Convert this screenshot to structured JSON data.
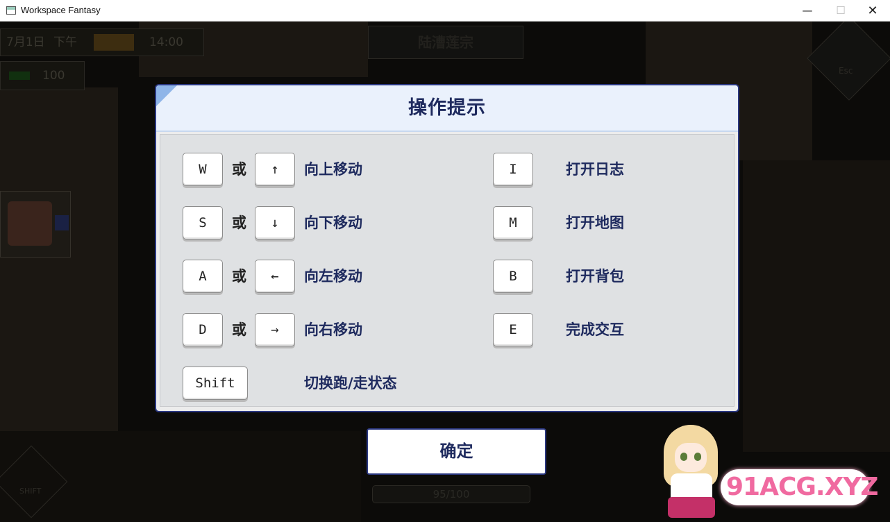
{
  "window": {
    "title": "Workspace Fantasy",
    "min": "—",
    "max": "☐",
    "close": "✕"
  },
  "hud": {
    "date": "7月1日",
    "period": "下午",
    "time": "14:00",
    "energy": "100",
    "location": "陆漕莲宗",
    "settings_label": "Esc",
    "shift_label": "SHIFT",
    "progress": "95/100"
  },
  "dialog": {
    "title": "操作提示",
    "or_label": "或",
    "left_controls": [
      {
        "key": "W",
        "alt_key": "↑",
        "action": "向上移动"
      },
      {
        "key": "S",
        "alt_key": "↓",
        "action": "向下移动"
      },
      {
        "key": "A",
        "alt_key": "←",
        "action": "向左移动"
      },
      {
        "key": "D",
        "alt_key": "→",
        "action": "向右移动"
      }
    ],
    "shift": {
      "key": "Shift",
      "action": "切换跑/走状态"
    },
    "right_controls": [
      {
        "key": "I",
        "action": "打开日志"
      },
      {
        "key": "M",
        "action": "打开地图"
      },
      {
        "key": "B",
        "action": "打开背包"
      },
      {
        "key": "E",
        "action": "完成交互"
      }
    ],
    "confirm_label": "确定"
  },
  "watermark": {
    "text": "91ACG.XYZ"
  }
}
